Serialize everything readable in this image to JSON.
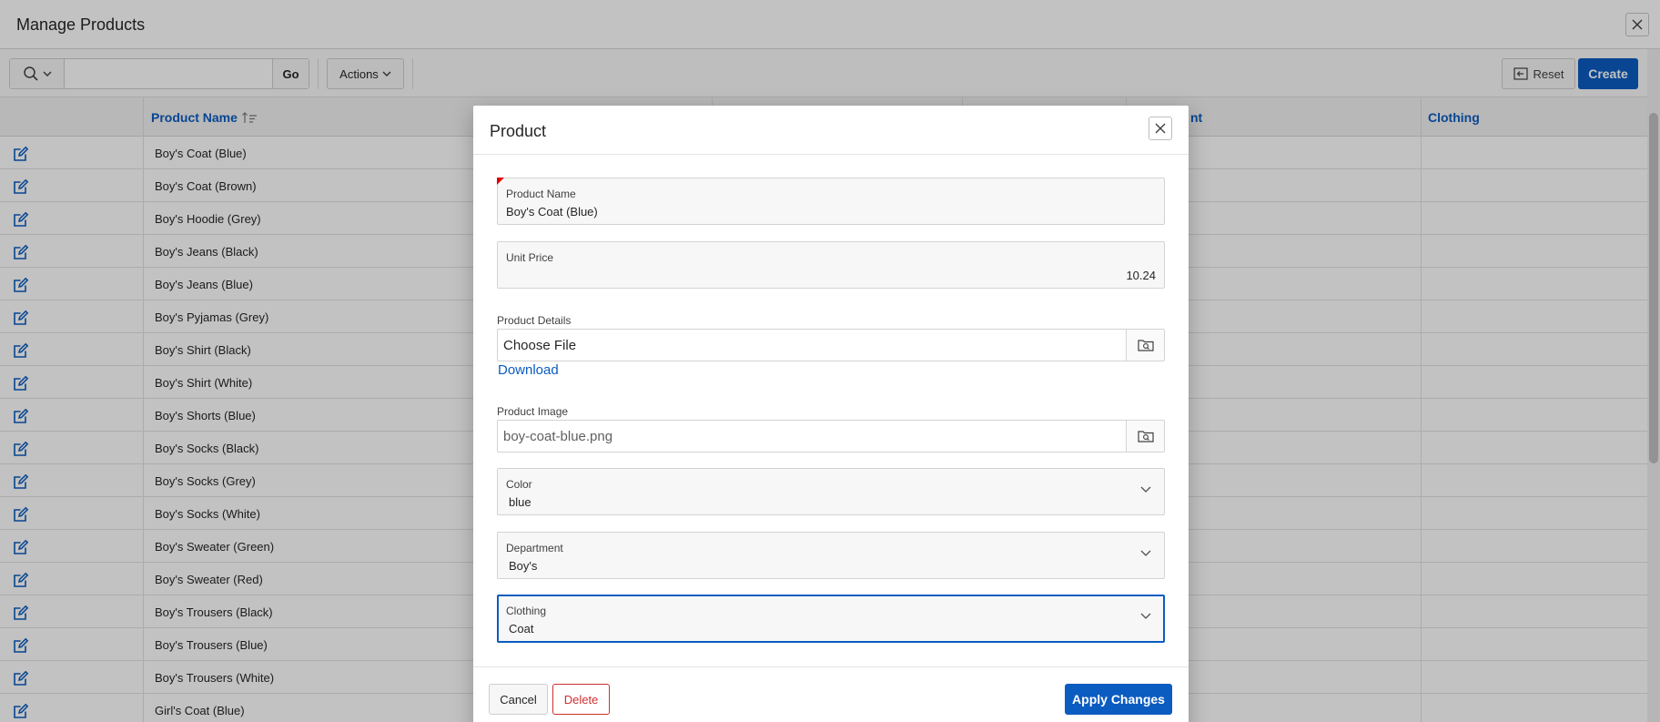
{
  "window": {
    "title": "Manage Products"
  },
  "toolbar": {
    "search_value": "",
    "go_label": "Go",
    "actions_label": "Actions",
    "reset_label": "Reset",
    "create_label": "Create"
  },
  "grid": {
    "columns": [
      "Product Name",
      "nt",
      "Clothing"
    ],
    "rows": [
      "Boy's Coat (Blue)",
      "Boy's Coat (Brown)",
      "Boy's Hoodie (Grey)",
      "Boy's Jeans (Black)",
      "Boy's Jeans (Blue)",
      "Boy's Pyjamas (Grey)",
      "Boy's Shirt (Black)",
      "Boy's Shirt (White)",
      "Boy's Shorts (Blue)",
      "Boy's Socks (Black)",
      "Boy's Socks (Grey)",
      "Boy's Socks (White)",
      "Boy's Sweater (Green)",
      "Boy's Sweater (Red)",
      "Boy's Trousers (Black)",
      "Boy's Trousers (Blue)",
      "Boy's Trousers (White)",
      "Girl's Coat (Blue)"
    ]
  },
  "dialog": {
    "title": "Product",
    "product_name": {
      "label": "Product Name",
      "value": "Boy's Coat (Blue)"
    },
    "unit_price": {
      "label": "Unit Price",
      "value": "10.24"
    },
    "product_details": {
      "label": "Product Details",
      "file_text": "Choose File",
      "download_label": "Download"
    },
    "product_image": {
      "label": "Product Image",
      "file_text": "boy-coat-blue.png"
    },
    "color": {
      "label": "Color",
      "value": "blue"
    },
    "department": {
      "label": "Department",
      "value": "Boy's"
    },
    "clothing": {
      "label": "Clothing",
      "value": "Coat"
    },
    "buttons": {
      "cancel": "Cancel",
      "delete": "Delete",
      "apply": "Apply Changes"
    }
  },
  "colors": {
    "accent": "#0b5cc1",
    "danger": "#cf2f2f",
    "required": "#e00000"
  },
  "icons": [
    "close-icon",
    "search-icon",
    "chevron-down-icon",
    "reset-icon",
    "sort-asc-icon",
    "edit-icon",
    "folder-browse-icon"
  ]
}
